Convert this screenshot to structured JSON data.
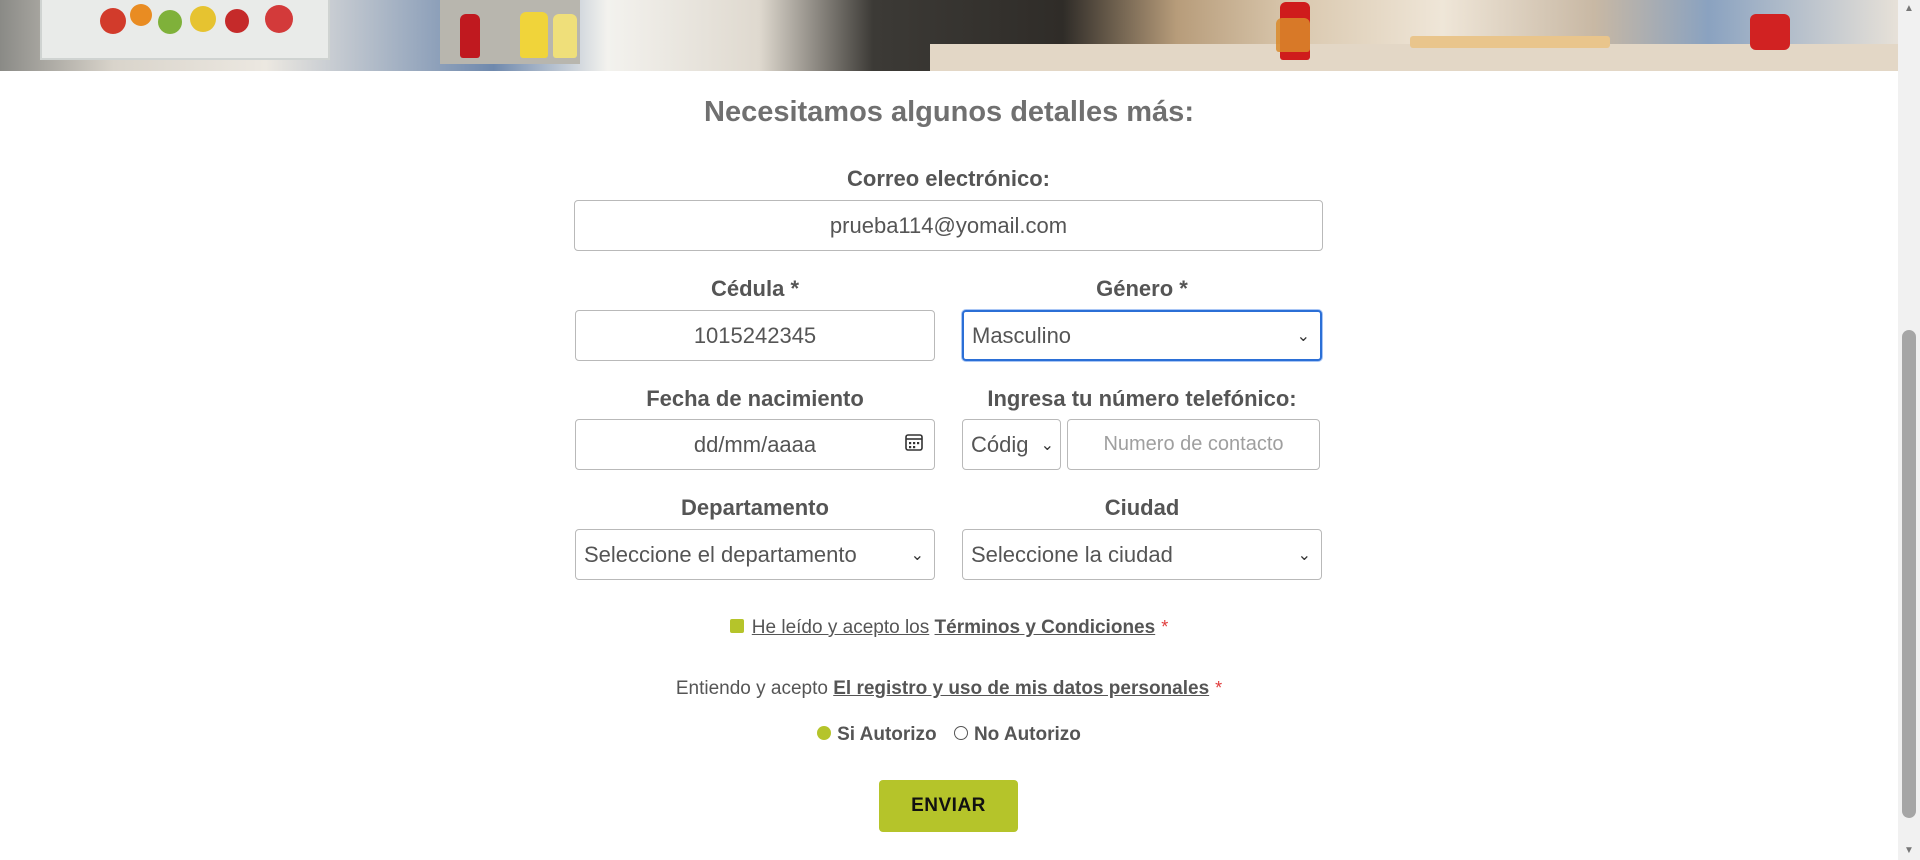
{
  "form": {
    "title": "Necesitamos algunos detalles más:",
    "email": {
      "label": "Correo electrónico:",
      "value": "prueba114@yomail.com"
    },
    "cedula": {
      "label": "Cédula *",
      "value": "1015242345"
    },
    "genero": {
      "label": "Género *",
      "value": "Masculino"
    },
    "birthdate": {
      "label": "Fecha de nacimiento",
      "placeholder": "dd/mm/aaaa"
    },
    "phone": {
      "label": "Ingresa tu número telefónico:",
      "code_value": "Códig",
      "number_placeholder": "Numero de contacto"
    },
    "departamento": {
      "label": "Departamento",
      "value": "Seleccione el departamento"
    },
    "ciudad": {
      "label": "Ciudad",
      "value": "Seleccione la ciudad"
    },
    "terms": {
      "prefix": "He leído y acepto los",
      "link": "Términos y Condiciones",
      "required": "*"
    },
    "data_usage": {
      "prefix": "Entiendo y acepto",
      "link": "El registro y uso de mis datos personales",
      "required": "*"
    },
    "authorization": {
      "yes": "Si Autorizo",
      "no": "No Autorizo",
      "selected": "Si Autorizo"
    },
    "submit_label": "ENVIAR"
  },
  "colors": {
    "accent": "#b5c42a",
    "focus": "#2b6fd6",
    "required": "#e03b3b"
  }
}
